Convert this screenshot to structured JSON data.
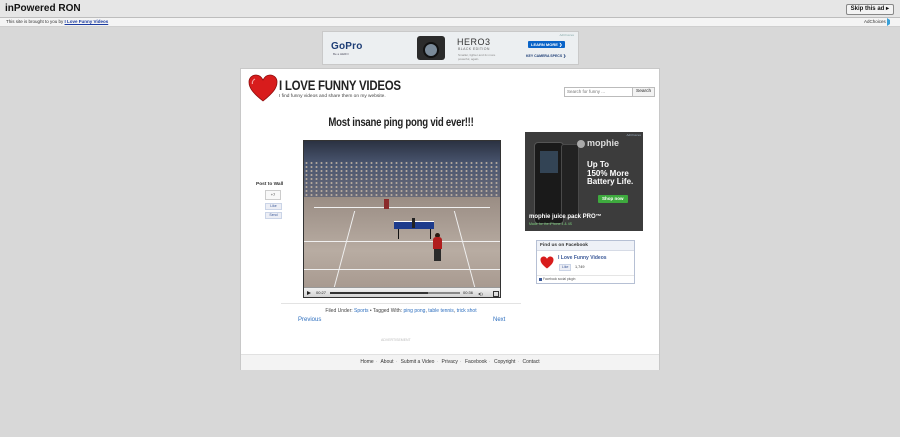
{
  "topbar": {
    "brand": "inPowered RON",
    "skip_label": "Skip this ad ▸"
  },
  "subbar": {
    "message": "This site is brought to you by",
    "link": "I Love Funny Videos",
    "adchoices": "AdChoices"
  },
  "leaderboard": {
    "brand": "GoPro",
    "brand_sub": "Be a HERO",
    "product": "HERO3",
    "edition": "BLACK EDITION",
    "text": "Smaller, lighter and 2x more powerful, again.",
    "cta": "LEARN MORE ❯",
    "link": "KEY CAMERA SPECS ❯",
    "adtag": "AdChoices"
  },
  "site": {
    "title": "I LOVE FUNNY VIDEOS",
    "tagline": "I find funny videos and share them on my website."
  },
  "search": {
    "placeholder": "Search for funny ...",
    "button": "Search"
  },
  "post": {
    "title": "Most insane ping pong vid ever!!!",
    "share": {
      "label": "Post to Wall",
      "count": "+7",
      "like": "Like",
      "send": "Send"
    },
    "video": {
      "current_time": "00:27",
      "duration": "00:36",
      "progress": 0.75
    },
    "filed_label": "Filed Under:",
    "category": "Sports",
    "tagged_label": "• Tagged With:",
    "tags": [
      "ping pong",
      "table tennis",
      "trick shot"
    ],
    "prev": "Previous",
    "next": "Next"
  },
  "footnote": "ADVERTISEMENT",
  "side_ad": {
    "brand": "mophie",
    "headline_1": "Up To",
    "headline_2": "150% More",
    "headline_3": "Battery Life.",
    "cta": "Shop now",
    "product": "mophie juice pack PRO™",
    "made": "Made for the iPhone 4 & 4S"
  },
  "facebook": {
    "header": "Find us on Facebook",
    "page_name": "I Love Funny Videos",
    "like": "Like",
    "count": "1,749",
    "plugin": "Facebook social plugin"
  },
  "footer": {
    "links": [
      "Home",
      "About",
      "Submit a Video",
      "Privacy",
      "Facebook",
      "Copyright",
      "Contact"
    ]
  },
  "colors": {
    "link": "#2e6fbf",
    "heart": "#d81c1c",
    "fb": "#3b5998",
    "background": "#d8d8d8"
  }
}
